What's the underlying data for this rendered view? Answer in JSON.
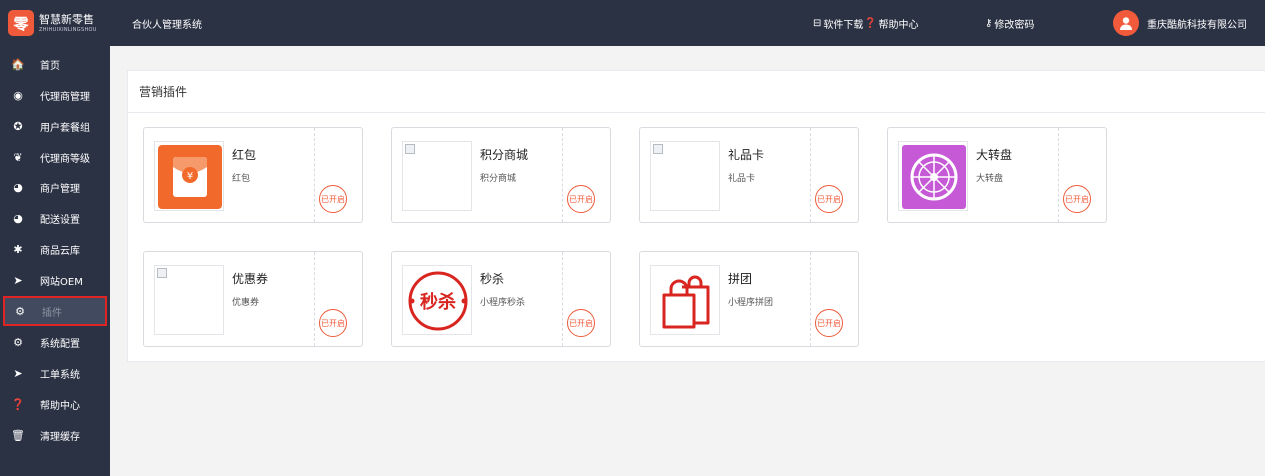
{
  "header": {
    "logo_cn": "智慧新零售",
    "logo_en": "ZHIHUIXINLINGSHOU",
    "logo_mark": "零",
    "system_title": "合伙人管理系统",
    "download": "软件下载",
    "help": "帮助中心",
    "change_password": "修改密码",
    "company": "重庆酷航科技有限公司"
  },
  "sidebar": {
    "items": [
      {
        "label": "首页",
        "icon": "home-icon",
        "glyph": "🏠"
      },
      {
        "label": "代理商管理",
        "icon": "compass-icon",
        "glyph": "◉"
      },
      {
        "label": "用户套餐组",
        "icon": "settings-icon",
        "glyph": "✪"
      },
      {
        "label": "代理商等级",
        "icon": "paw-icon",
        "glyph": "❦"
      },
      {
        "label": "商户管理",
        "icon": "user-circle-icon",
        "glyph": "◕"
      },
      {
        "label": "配送设置",
        "icon": "user-circle-icon",
        "glyph": "◕"
      },
      {
        "label": "商品云库",
        "icon": "asterisk-icon",
        "glyph": "✱"
      },
      {
        "label": "网站OEM",
        "icon": "send-icon",
        "glyph": "➤"
      },
      {
        "label": "插件",
        "icon": "gears-icon",
        "glyph": "⚙"
      },
      {
        "label": "系统配置",
        "icon": "gears-icon",
        "glyph": "⚙"
      },
      {
        "label": "工单系统",
        "icon": "send-icon",
        "glyph": "➤"
      },
      {
        "label": "帮助中心",
        "icon": "question-icon",
        "glyph": "❓"
      },
      {
        "label": "清理缓存",
        "icon": "trash-icon",
        "glyph": "🗑"
      }
    ],
    "active_index": 8
  },
  "main": {
    "panel_title": "营销插件",
    "plugins": [
      {
        "name": "红包",
        "desc": "红包",
        "status": "已开启",
        "image": "red-envelope-icon"
      },
      {
        "name": "积分商城",
        "desc": "积分商城",
        "status": "已开启",
        "image": "broken-image-icon"
      },
      {
        "name": "礼品卡",
        "desc": "礼品卡",
        "status": "已开启",
        "image": "broken-image-icon"
      },
      {
        "name": "大转盘",
        "desc": "大转盘",
        "status": "已开启",
        "image": "spin-wheel-icon"
      },
      {
        "name": "优惠券",
        "desc": "优惠券",
        "status": "已开启",
        "image": "broken-image-icon"
      },
      {
        "name": "秒杀",
        "desc": "小程序秒杀",
        "status": "已开启",
        "image": "flash-sale-seal-icon",
        "seal_text": "秒杀"
      },
      {
        "name": "拼团",
        "desc": "小程序拼团",
        "status": "已开启",
        "image": "shopping-bags-icon"
      }
    ]
  },
  "colors": {
    "sidebar_bg": "#2b3244",
    "accent": "#ef5b3a",
    "active_border": "#e02424",
    "wheel": "#c65ad6"
  }
}
